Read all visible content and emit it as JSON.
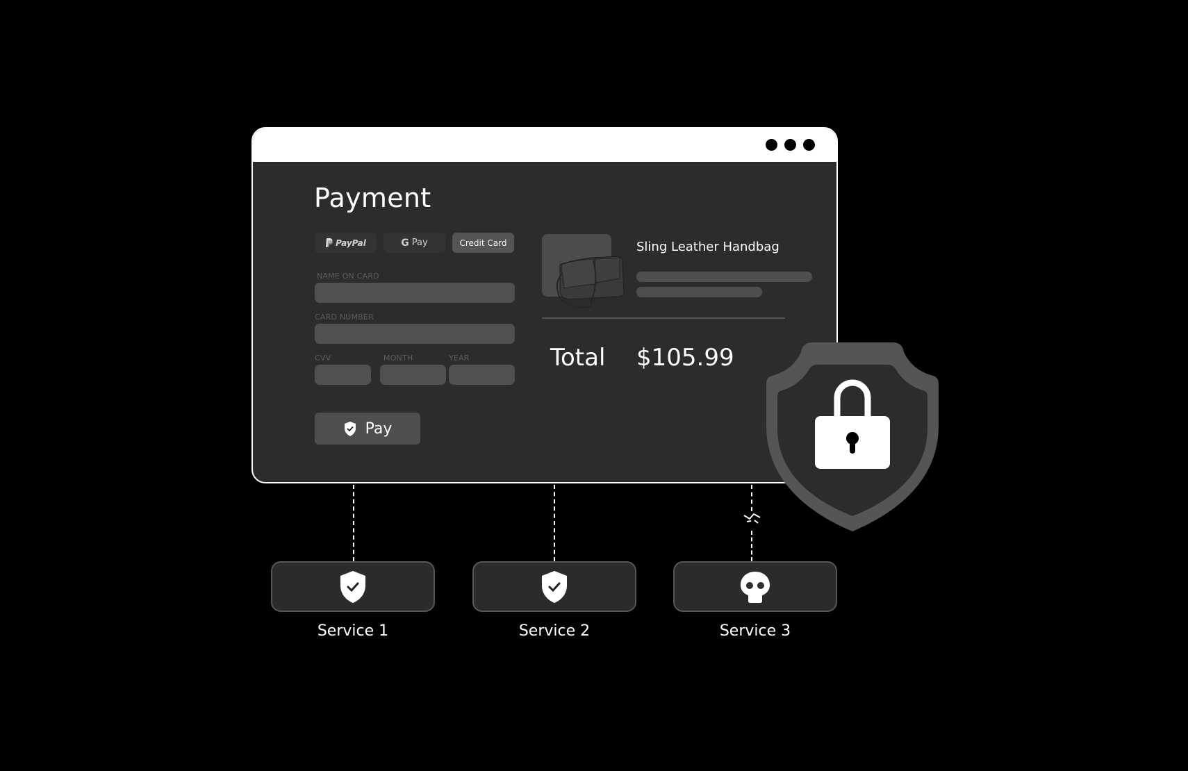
{
  "window": {
    "controls": [
      "dot",
      "dot",
      "dot"
    ]
  },
  "payment": {
    "title": "Payment",
    "methods": [
      {
        "label": "PayPal",
        "icon": "paypal-icon",
        "active": false
      },
      {
        "label": "Pay",
        "icon": "google-g-icon",
        "active": false
      },
      {
        "label": "Credit Card",
        "icon": "",
        "active": true
      }
    ],
    "fields": {
      "name_on_card": {
        "label": "NAME ON CARD",
        "value": ""
      },
      "card_number": {
        "label": "CARD NUMBER",
        "value": ""
      },
      "cvv": {
        "label": "CVV",
        "value": ""
      },
      "month": {
        "label": "MONTH",
        "value": ""
      },
      "year": {
        "label": "YEAR",
        "value": ""
      }
    },
    "pay_button": {
      "label": "Pay",
      "icon": "shield-check-icon"
    }
  },
  "order": {
    "product_name": "Sling Leather Handbag",
    "product_image": "handbag-image",
    "total_label": "Total",
    "total_value": "$105.99"
  },
  "security": {
    "badge_icon": "shield-lock-icon"
  },
  "services": [
    {
      "label": "Service 1",
      "icon": "shield-check-icon",
      "status": "secure",
      "connection": "connected"
    },
    {
      "label": "Service 2",
      "icon": "shield-check-icon",
      "status": "secure",
      "connection": "connected"
    },
    {
      "label": "Service 3",
      "icon": "skull-icon",
      "status": "compromised",
      "connection": "broken"
    }
  ],
  "colors": {
    "background": "#000000",
    "panel": "#2c2c2c",
    "field": "#505050",
    "accent": "#ffffff",
    "shield_outer": "#555555"
  }
}
